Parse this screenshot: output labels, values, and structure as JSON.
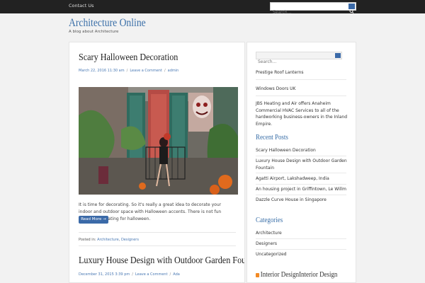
{
  "topbar": {
    "contact": "Contact Us",
    "search_placeholder": "Search..."
  },
  "site": {
    "title": "Architecture Online",
    "tagline": "A blog about Architecture"
  },
  "posts": [
    {
      "title": "Scary Halloween Decoration",
      "date": "March 22, 2016 11:30 am",
      "comments": "Leave a Comment",
      "author": "admin",
      "excerpt": "It is time for decorating. So it's really a great idea to decorate your indoor and outdoor space with Halloween accents. There is not fun without decorating for halloween.",
      "read_more": "Read More →",
      "posted_label": "Posted in:",
      "category_1": "Architecture",
      "category_2": "Designers"
    },
    {
      "title": "Luxury House Design with Outdoor Garden Fountain",
      "date": "December 31, 2015 3:39 pm",
      "comments": "Leave a Comment",
      "author": "Ada"
    }
  ],
  "sidebar": {
    "search_placeholder": "Search...",
    "links": [
      "Prestige Roof Lanterns",
      "Windows Doors UK",
      "JBS Heating and Air offers Anaheim Commercial HVAC Services to all of the hardworking business-owners in the Inland Empire."
    ],
    "recent_posts_heading": "Recent Posts",
    "recent_posts": [
      "Scary Halloween Decoration",
      "Luxury House Design with Outdoor Garden Fountain",
      "Agatti Airport, Lakshadweep, India",
      "An housing project in Griffintown, Le Willm",
      "Dazzle Curve House in Singapore"
    ],
    "categories_heading": "Categories",
    "categories": [
      "Architecture",
      "Designers",
      "Uncategorized"
    ],
    "rss_heading": "Interior DesignInterior Design"
  },
  "colors": {
    "accent": "#3b6aa8",
    "title_blue": "#3a6fa8",
    "topbar": "#222222"
  }
}
